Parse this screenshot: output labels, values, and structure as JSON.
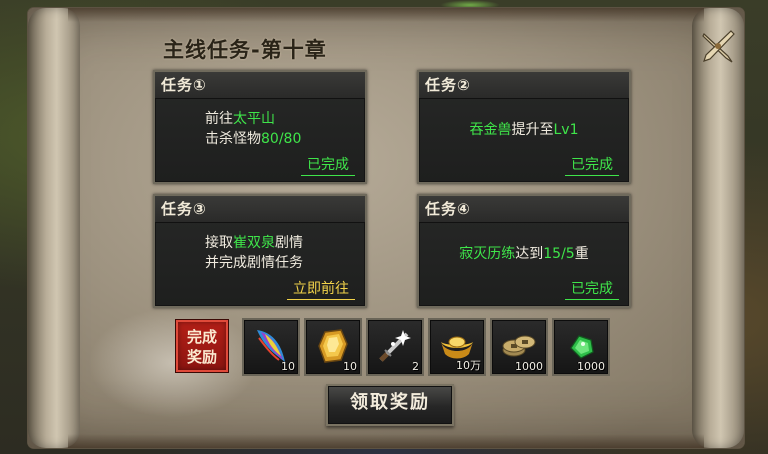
{
  "window": {
    "title": "主线任务-第十章"
  },
  "tasks": [
    {
      "header": "任务①",
      "lines": [
        {
          "pre": "前往",
          "hl": "太平山",
          "post": ""
        },
        {
          "pre": "击杀怪物",
          "hl": "80/80",
          "post": ""
        }
      ],
      "status": "已完成"
    },
    {
      "header": "任务②",
      "lines": [
        {
          "pre": "",
          "hl": "吞金兽",
          "post": "提升至",
          "hl2": "Lv1"
        }
      ],
      "status": "已完成"
    },
    {
      "header": "任务③",
      "lines": [
        {
          "pre": "接取",
          "hl": "崔双泉",
          "post": "剧情"
        },
        {
          "pre": "并完成剧情任务",
          "hl": "",
          "post": ""
        }
      ],
      "status": "立即前往"
    },
    {
      "header": "任务④",
      "lines": [
        {
          "pre": "",
          "hl": "寂灭历练",
          "post": "达到",
          "hl2": "15/5",
          "post2": "重"
        }
      ],
      "status": "已完成"
    }
  ],
  "rewards": {
    "label": "完成奖励",
    "items": [
      {
        "icon": "feather-wing-icon",
        "qty": "10"
      },
      {
        "icon": "gold-crystal-icon",
        "qty": "10"
      },
      {
        "icon": "sparkling-sword-icon",
        "qty": "2"
      },
      {
        "icon": "gold-ingot-icon",
        "qty": "10万"
      },
      {
        "icon": "coin-stack-icon",
        "qty": "1000"
      },
      {
        "icon": "green-jade-icon",
        "qty": "1000"
      }
    ]
  },
  "actions": {
    "claim_label": "领取奖励"
  },
  "colors": {
    "highlight": "#3fe54a",
    "link": "#f2d34a",
    "reward_badge": "#b41f17"
  }
}
